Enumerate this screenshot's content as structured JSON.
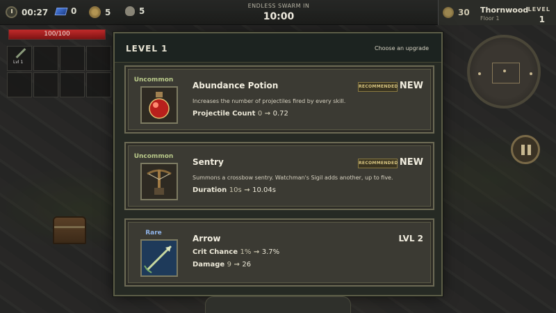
{
  "hud": {
    "timer": "00:27",
    "gems": "0",
    "coins": "5",
    "kills": "5",
    "hp_text": "100/100",
    "hp_fraction": 1.0
  },
  "swarm": {
    "title": "ENDLESS SWARM IN",
    "time": "10:00"
  },
  "player": {
    "coins": "30",
    "name": "Thornwood",
    "floor": "Floor 1",
    "level_label": "LEVEL",
    "level": "1"
  },
  "slots": {
    "first_slot_label": "Lvl 1"
  },
  "panel": {
    "title": "LEVEL 1",
    "hint": "Choose an upgrade"
  },
  "cards": [
    {
      "rarity": "Uncommon",
      "name": "Abundance Potion",
      "description": "Increases the number of projectiles fired by every skill.",
      "recommended": "RECOMMENDED",
      "tag": "NEW",
      "icon": "potion-icon",
      "stats": [
        {
          "label": "Projectile Count",
          "from": "0",
          "to": "0.72"
        }
      ]
    },
    {
      "rarity": "Uncommon",
      "name": "Sentry",
      "description": "Summons a crossbow sentry. Watchman's Sigil adds another, up to five.",
      "recommended": "RECOMMENDED",
      "tag": "NEW",
      "icon": "crossbow-icon",
      "stats": [
        {
          "label": "Duration",
          "from": "10s",
          "to": "10.04s"
        }
      ]
    },
    {
      "rarity": "Rare",
      "name": "Arrow",
      "tag": "LVL 2",
      "icon": "arrow-icon",
      "stats": [
        {
          "label": "Crit Chance",
          "from": "1%",
          "to": "3.7%"
        },
        {
          "label": "Damage",
          "from": "9",
          "to": "26"
        }
      ]
    }
  ],
  "arrow_glyph": "→",
  "colors": {
    "hp": "#c12a2a",
    "uncommon": "#b9c98a",
    "rare": "#8fb3e8",
    "recommended": "#d9c682"
  }
}
